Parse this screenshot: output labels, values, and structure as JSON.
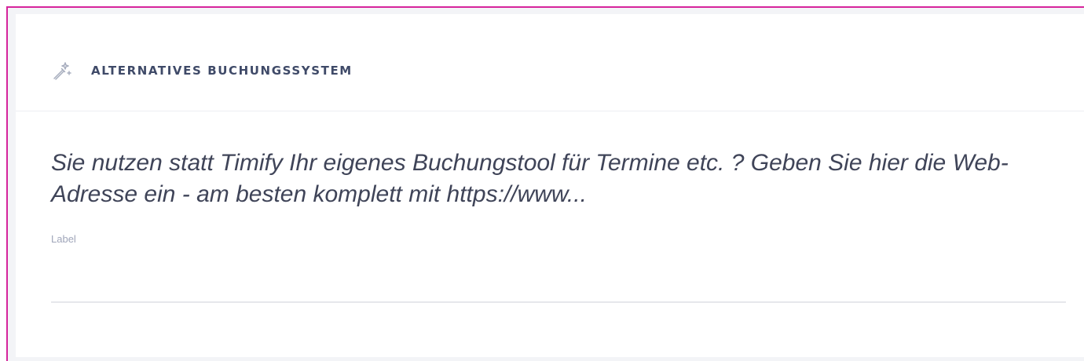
{
  "section": {
    "icon": "magic-wand-icon",
    "title": "ALTERNATIVES BUCHUNGSSYSTEM"
  },
  "field": {
    "description": "Sie nutzen statt Timify Ihr eigenes Buchungstool für Termine etc. ? Geben Sie hier die Web-Adresse ein - am besten komplett mit https://www...",
    "label": "Label",
    "value": ""
  },
  "colors": {
    "frame_border": "#d6249c",
    "title": "#3f4a68",
    "body_text": "#3f4458",
    "muted_label": "#a0a6ba",
    "input_underline": "#e6e7eb"
  }
}
